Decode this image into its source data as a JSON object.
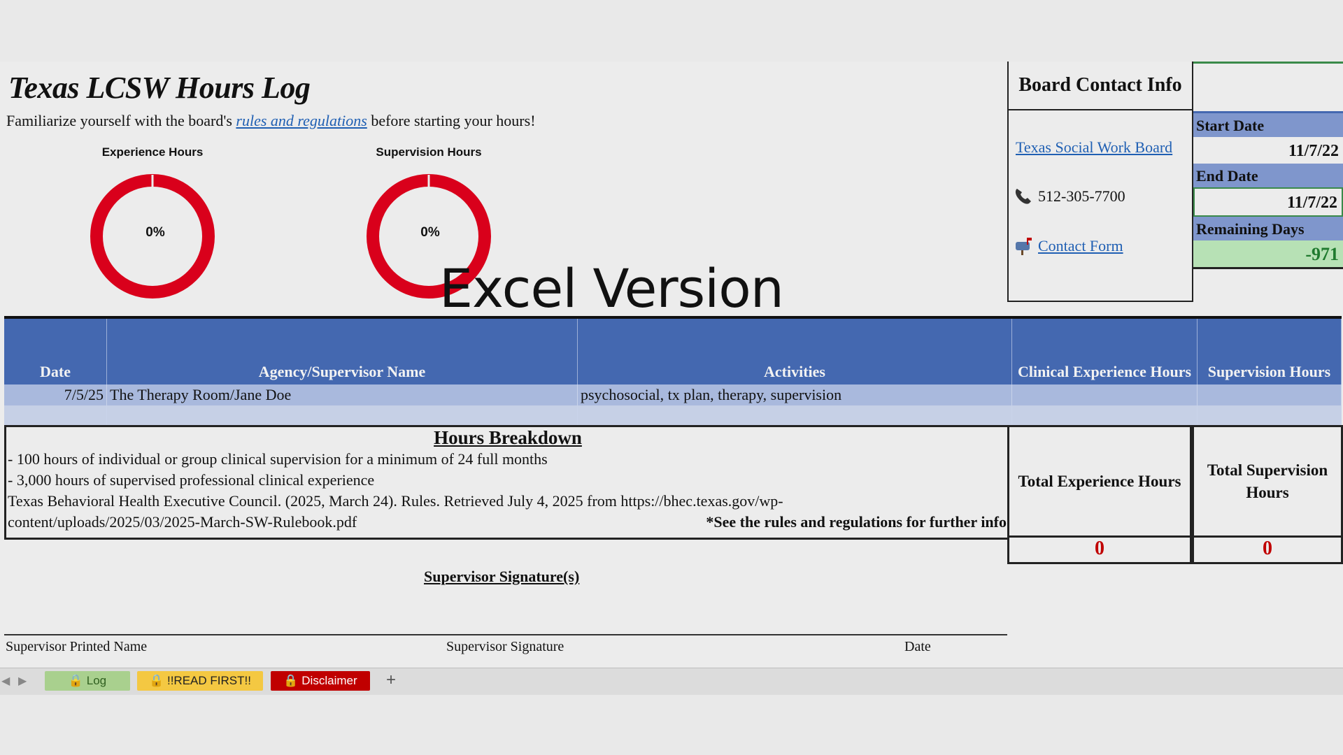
{
  "title": "Texas LCSW Hours Log",
  "intro": {
    "before": "Familiarize yourself with the board's ",
    "link": "rules and regulations",
    "after": " before starting your hours!"
  },
  "charts": {
    "experience": {
      "label": "Experience Hours",
      "percent": "0%",
      "value": 0
    },
    "supervision": {
      "label": "Supervision Hours",
      "percent": "0%",
      "value": 0
    }
  },
  "overlay_text": "Excel Version",
  "board": {
    "title": "Board Contact Info",
    "site_link": "Texas Social Work Board",
    "phone": "512-305-7700",
    "contact_link": "Contact Form",
    "phone_icon": "telephone-icon",
    "mailbox_icon": "mailbox-icon"
  },
  "dates": {
    "start_label": "Start Date",
    "start_value": "11/7/22",
    "end_label": "End Date",
    "end_value": "11/7/22",
    "remaining_label": "Remaining Days",
    "remaining_value": "-971"
  },
  "table": {
    "headers": [
      "Date",
      "Agency/Supervisor Name",
      "Activities",
      "Clinical Experience Hours",
      "Supervision Hours"
    ],
    "rows": [
      [
        "7/5/25",
        "The Therapy Room/Jane Doe",
        "psychosocial, tx plan, therapy, supervision",
        "",
        ""
      ],
      [
        "",
        "",
        "",
        "",
        ""
      ]
    ]
  },
  "breakdown": {
    "title": "Hours Breakdown",
    "line1": "- 100 hours of individual or group clinical supervision for a minimum of 24 full months",
    "line2": "- 3,000 hours of supervised professional clinical experience",
    "line3": "Texas Behavioral Health Executive Council. (2025, March 24). Rules. Retrieved July 4, 2025 from https://bhec.texas.gov/wp-",
    "line4": "content/uploads/2025/03/2025-March-SW-Rulebook.pdf",
    "note": "*See the rules and regulations for further info"
  },
  "totals": {
    "exp_label": "Total Experience Hours",
    "exp_value": "0",
    "sup_label": "Total Supervision Hours",
    "sup_value": "0"
  },
  "signature": {
    "title": "Supervisor Signature(s)",
    "printed_name": "Supervisor Printed Name",
    "signature": "Supervisor Signature",
    "date": "Date"
  },
  "tabs": [
    {
      "label": "Log",
      "color": "#a9d08e"
    },
    {
      "label": "!!READ FIRST!!",
      "color": "#f4c842"
    },
    {
      "label": "Disclaimer",
      "color": "#c00000"
    }
  ],
  "colors": {
    "header_blue": "#4468b0",
    "donut_red": "#d9001b",
    "remaining_green": "#b7e1b5",
    "total_red": "#c00000"
  }
}
